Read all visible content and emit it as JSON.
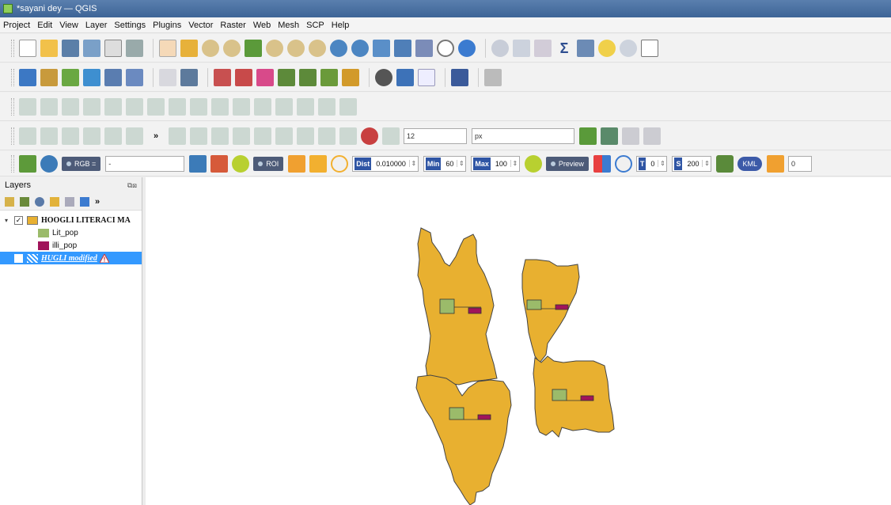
{
  "window": {
    "title": "*sayani dey — QGIS"
  },
  "menu": [
    "Project",
    "Edit",
    "View",
    "Layer",
    "Settings",
    "Plugins",
    "Vector",
    "Raster",
    "Web",
    "Mesh",
    "SCP",
    "Help"
  ],
  "toolbar_labeling": {
    "font_size": "12",
    "unit": "px"
  },
  "scp_toolbar": {
    "band_combo": "RGB =",
    "band_value": "-",
    "roi_label": "ROI",
    "dist_label": "Dist",
    "dist_value": "0.010000",
    "min_label": "Min",
    "min_value": "60",
    "max_label": "Max",
    "max_value": "100",
    "preview_label": "Preview",
    "t_label": "T",
    "t_value": "0",
    "s_label": "S",
    "s_value": "200",
    "last_value": "0",
    "kml_label": "KML"
  },
  "layers_panel": {
    "title": "Layers",
    "group_layer": "HOOGLI LITERACI MA",
    "legend_items": [
      {
        "label": "Lit_pop",
        "color": "#9bbb6a"
      },
      {
        "label": "illi_pop",
        "color": "#a0145a"
      }
    ],
    "selected_layer": "HUGLI modified"
  },
  "colors": {
    "polygon_fill": "#e8b030",
    "polygon_stroke": "#444444",
    "lit_pop": "#9bbb6a",
    "illi_pop": "#a0145a",
    "selection": "#3399ff"
  }
}
